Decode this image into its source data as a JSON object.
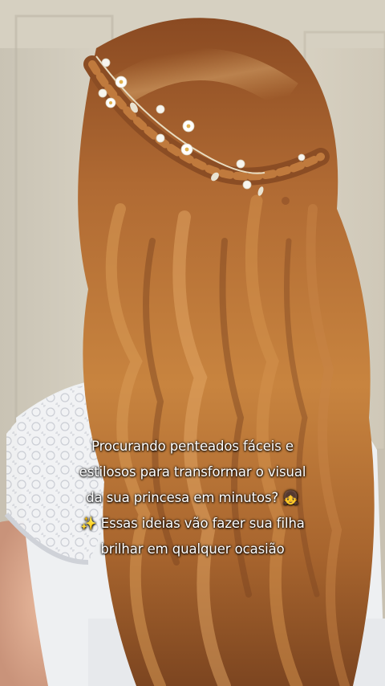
{
  "post": {
    "caption_lines": [
      "Procurando penteados fáceis e",
      "estilosos para transformar o visual",
      "da sua princesa em minutos? 👧",
      "✨ Essas ideias vão fazer sua filha",
      "brilhar em qualquer ocasião"
    ]
  },
  "photo": {
    "subject_icon": "hairstyle-photo",
    "colors": {
      "hair": "#a8642e",
      "dress": "#eef0f2",
      "background": "#d8d2c4"
    }
  }
}
